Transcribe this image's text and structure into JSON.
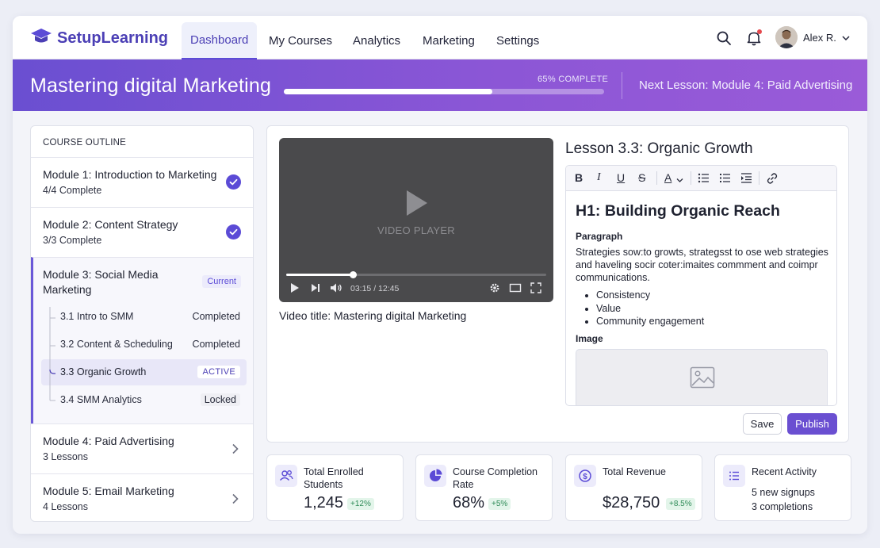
{
  "brand": {
    "name": "SetupLearning",
    "accent": "#5b4bd6"
  },
  "nav": {
    "tabs": [
      {
        "label": "Dashboard",
        "active": true
      },
      {
        "label": "My Courses"
      },
      {
        "label": "Analytics"
      },
      {
        "label": "Marketing"
      },
      {
        "label": "Settings"
      }
    ],
    "icons": [
      "search-icon",
      "bell-icon"
    ],
    "user": {
      "name": "Alex R."
    }
  },
  "header": {
    "course_title": "Mastering digital Marketing",
    "progress_label": "65% COMPLETE",
    "progress": 0.65,
    "next_lesson": "Next Lesson: Module 4: Paid Advertising"
  },
  "outline": {
    "title": "COURSE OUTLINE",
    "modules": [
      {
        "name": "Module 1: Introduction to Marketing",
        "sub": "4/4 Complete",
        "state": "complete"
      },
      {
        "name": "Module 2: Content Strategy",
        "sub": "3/3 Complete",
        "state": "complete"
      },
      {
        "name": "Module 3: Social Media",
        "name2": "Marketing",
        "badge": "Current",
        "state": "current",
        "lessons": [
          {
            "name": "3.1 Intro to SMM",
            "status": "Completed"
          },
          {
            "name": "3.2 Content & Scheduling",
            "status": "Completed"
          },
          {
            "name": "3.3 Organic Growth",
            "status": "ACTIVE"
          },
          {
            "name": "3.4 SMM Analytics",
            "status": "Locked"
          }
        ]
      },
      {
        "name": "Module 4: Paid Advertising",
        "sub": "3 Lessons",
        "state": "collapsed"
      },
      {
        "name": "Module 5: Email Marketing",
        "sub": "4 Lessons",
        "state": "collapsed"
      }
    ]
  },
  "video": {
    "placeholder": "VIDEO PLAYER",
    "time": "03:15 / 12:45",
    "played_fraction": 0.255,
    "title": "Video title: Mastering digital Marketing"
  },
  "editor": {
    "lesson_heading": "Lesson 3.3: Organic Growth",
    "h1": "H1: Building Organic Reach",
    "paragraph_label": "Paragraph",
    "paragraph": "Strategies sow:to growts, strategsst to ose web strategies and haveling socir coter:imaites commment and coimpr communications.",
    "bullets": [
      "Consistency",
      "Value",
      "Community engagement"
    ],
    "image_label": "Image",
    "toolbar": {
      "bold": "B",
      "italic": "I",
      "underline": "U",
      "strike": "S",
      "color": "A"
    },
    "save_label": "Save",
    "publish_label": "Publish"
  },
  "stats": [
    {
      "label": "Total Enrolled Students",
      "value": "1,245",
      "delta": "+12%",
      "icon": "users-icon"
    },
    {
      "label": "Course Completion Rate",
      "value": "68%",
      "delta": "+5%",
      "icon": "pie-chart-icon"
    },
    {
      "label": "Total Revenue",
      "value": "$28,750",
      "delta": "+8.5%",
      "icon": "dollar-icon"
    },
    {
      "label": "Recent Activity",
      "lines": [
        "5 new signups",
        "3 completions"
      ],
      "icon": "list-icon"
    }
  ]
}
